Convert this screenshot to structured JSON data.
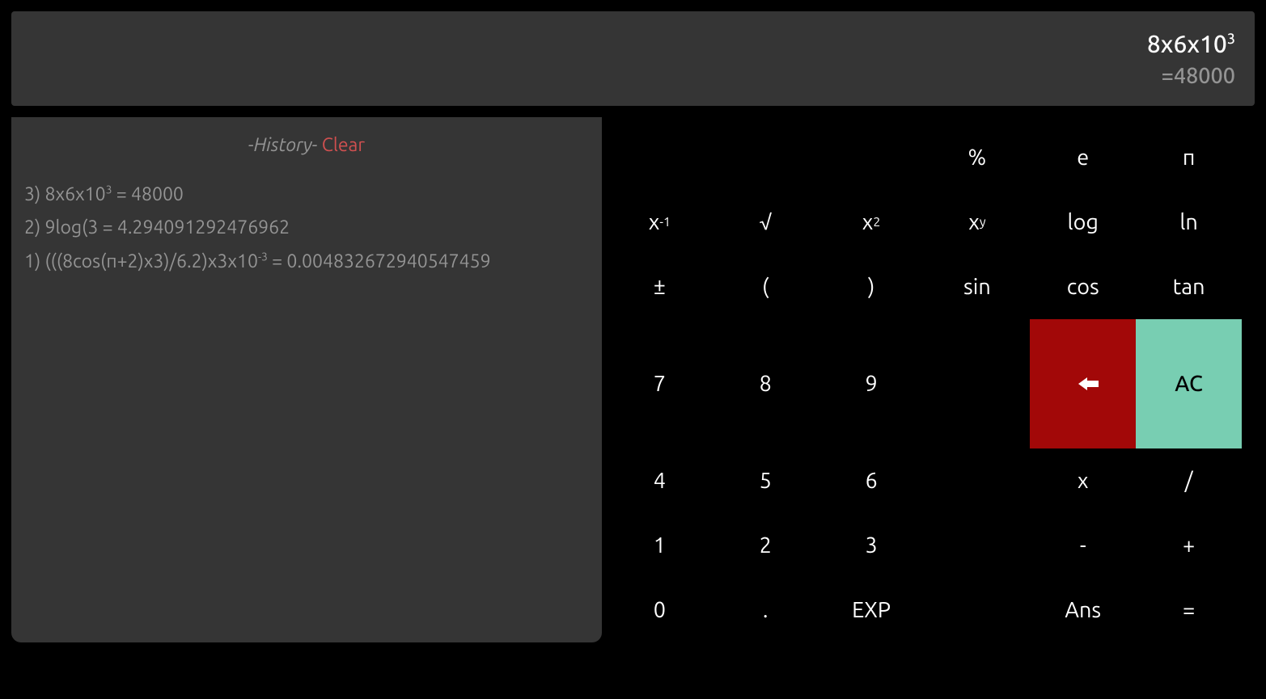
{
  "display": {
    "expression_base": "8x6x10",
    "expression_exp": "3",
    "result": "=48000"
  },
  "history": {
    "title": "-History-",
    "clear": "Clear",
    "items": [
      {
        "prefix": "3) 8x6x10",
        "sup": "3",
        "suffix": " = 48000"
      },
      {
        "prefix": "2) 9log(3 = 4.294091292476962",
        "sup": "",
        "suffix": ""
      },
      {
        "prefix": "1) (((8cos(π+2)x3)/6.2)x3x10",
        "sup": "-3",
        "suffix": " = 0.004832672940547459"
      }
    ]
  },
  "keys": {
    "percent": "%",
    "e": "e",
    "pi": "π",
    "inv_base": "x ",
    "inv_exp": "-1",
    "sqrt": "√",
    "sq_base": "x",
    "sq_exp": "2",
    "pow_base": "x",
    "pow_exp": "y",
    "log": "log",
    "ln": "ln",
    "plusminus": "±",
    "lparen": "(",
    "rparen": ")",
    "sin": "sin",
    "cos": "cos",
    "tan": "tan",
    "d7": "7",
    "d8": "8",
    "d9": "9",
    "ac": "AC",
    "d4": "4",
    "d5": "5",
    "d6": "6",
    "mult": "x",
    "div": "/",
    "d1": "1",
    "d2": "2",
    "d3": "3",
    "minus": "-",
    "plus": "+",
    "d0": "0",
    "dot": ".",
    "exp": "EXP",
    "ans": "Ans",
    "eq": "="
  }
}
